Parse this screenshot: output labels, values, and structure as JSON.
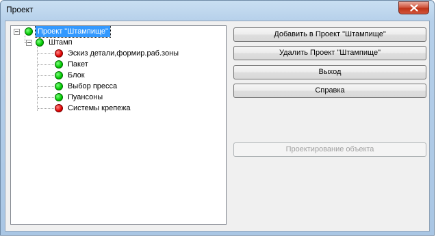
{
  "window": {
    "title": "Проект"
  },
  "tree": {
    "root": {
      "label": "Проект \"Штампище\"",
      "status": "green"
    },
    "child": {
      "label": "Штамп",
      "status": "green"
    },
    "items": [
      {
        "label": "Эскиз детали,формир.раб.зоны",
        "status": "red"
      },
      {
        "label": "Пакет",
        "status": "green"
      },
      {
        "label": "Блок",
        "status": "green"
      },
      {
        "label": "Выбор пресса",
        "status": "green"
      },
      {
        "label": "Пуансоны",
        "status": "green"
      },
      {
        "label": "Системы крепежа",
        "status": "red"
      }
    ]
  },
  "buttons": {
    "add": "Добавить в Проект \"Штампище\"",
    "delete": "Удалить Проект \"Штампище\"",
    "exit": "Выход",
    "help": "Справка",
    "design": "Проектирование объекта"
  },
  "colors": {
    "selection": "#3399ff",
    "green": "#00c800",
    "red": "#e00000"
  }
}
